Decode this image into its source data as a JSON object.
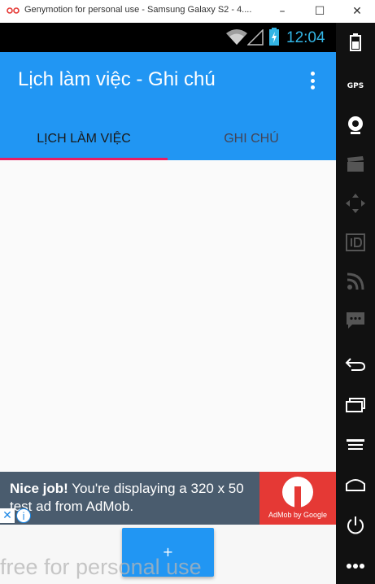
{
  "window": {
    "title": "Genymotion for personal use - Samsung Galaxy S2 - 4....",
    "minimize_glyph": "–",
    "maximize_glyph": "☐",
    "close_glyph": "✕"
  },
  "status_bar": {
    "time": "12:04",
    "time_color": "#33b5e5",
    "icons": [
      "wifi-icon",
      "signal-icon",
      "battery-icon"
    ]
  },
  "app_bar": {
    "title": "Lịch làm việc - Ghi chú",
    "color": "#2196f3",
    "overflow_icon": "more-vert-icon"
  },
  "tabs": [
    {
      "label": "LỊCH LÀM VIỆC",
      "selected": true
    },
    {
      "label": "GHI CHÚ",
      "selected": false
    }
  ],
  "tab_indicator_color": "#e91e63",
  "ad": {
    "bold": "Nice job!",
    "text": " You're displaying a 320 x 50 test ad from AdMob.",
    "logo_caption": "AdMob by Google",
    "close_glyph": "✕",
    "info_glyph": "i"
  },
  "fab": {
    "label": "+"
  },
  "watermark": "free for personal use",
  "sidebar": {
    "gps_label": "GPS",
    "icons": [
      "battery-icon",
      "gps-icon",
      "webcam-icon",
      "capture-icon",
      "dpad-icon",
      "id-icon",
      "rss-icon",
      "sms-icon",
      "back-icon",
      "recent-apps-icon",
      "menu-icon",
      "home-icon",
      "power-icon",
      "more-icon"
    ]
  }
}
